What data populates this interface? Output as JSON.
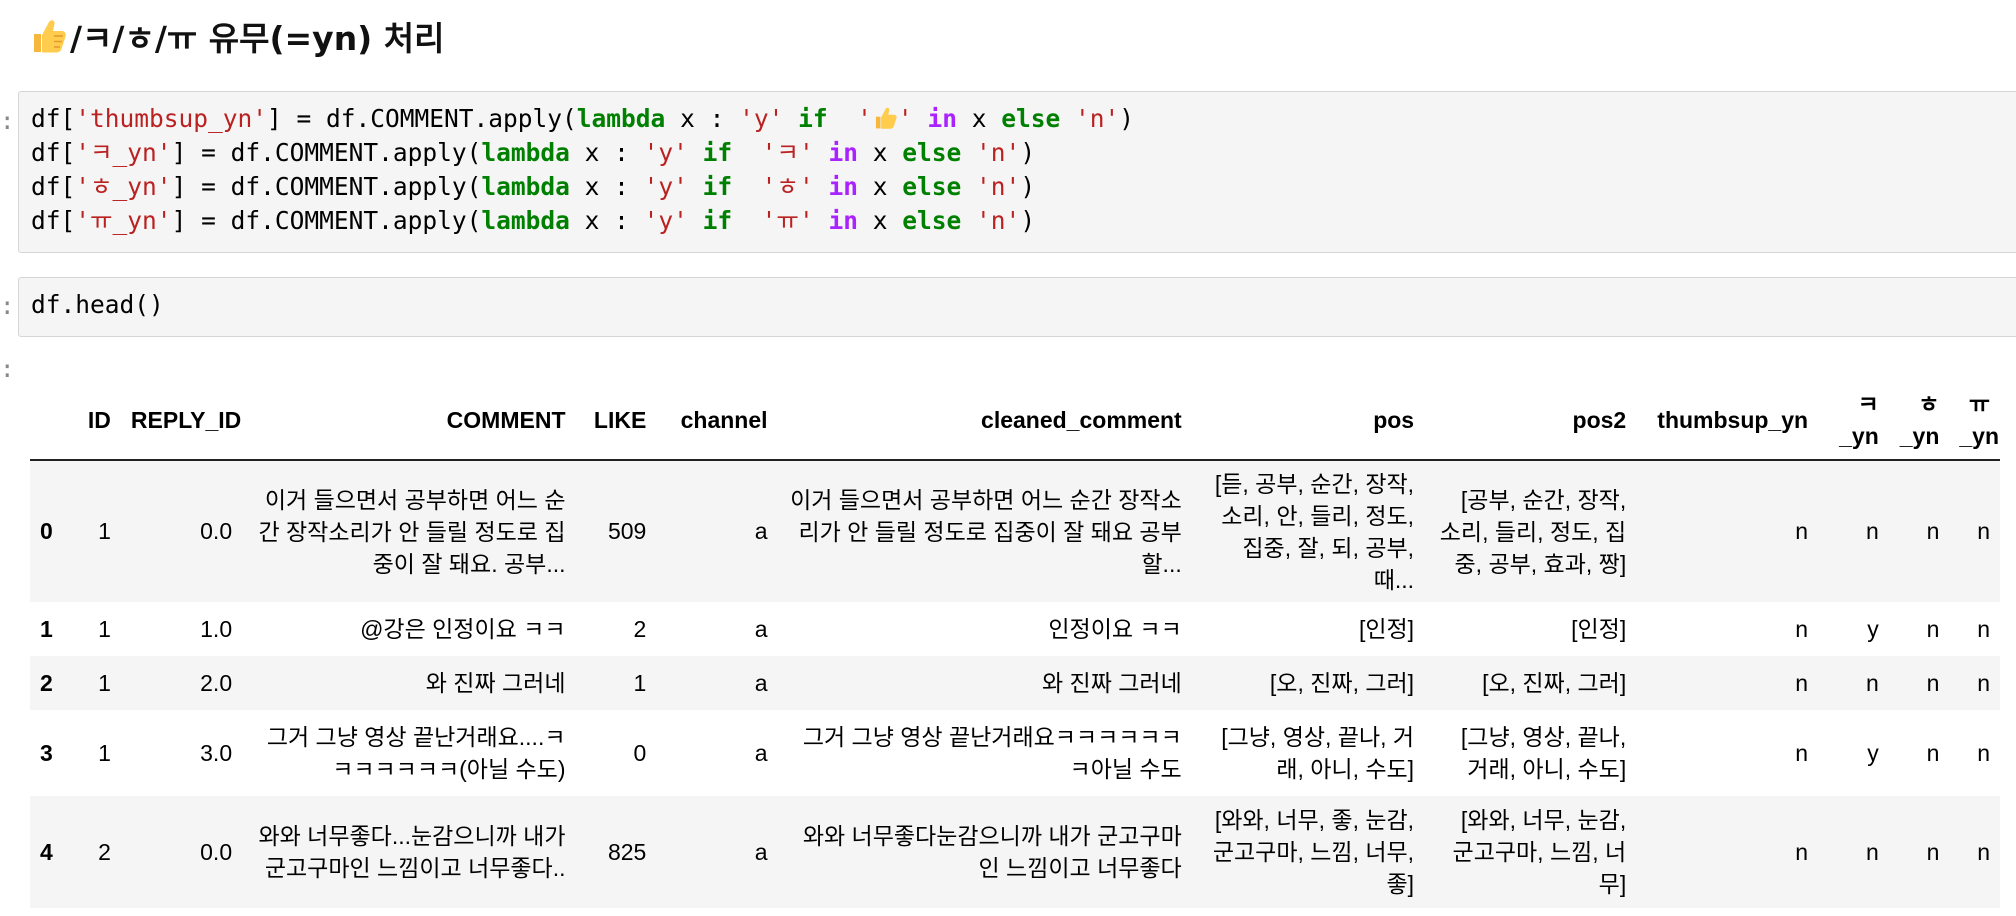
{
  "heading": {
    "text": "/ㅋ/ㅎ/ㅠ 유무(=yn) 처리",
    "icon": "thumbs-up-icon"
  },
  "cell1": {
    "lines": [
      {
        "df": "df[",
        "key": "'thumbsup_yn'",
        "mid": "] = df.COMMENT.apply(",
        "lambda": "lambda",
        "x1": " x : ",
        "y": "'y'",
        "sp": " ",
        "if": "if",
        "sp2": "  ",
        "q1": "'",
        "q2": "'",
        "in": "in",
        "x2": " x ",
        "else": "else",
        "n": "'n'",
        "close": ")"
      },
      {
        "df": "df[",
        "key": "'ㅋ_yn'",
        "mid": "] = df.COMMENT.apply(",
        "lambda": "lambda",
        "x1": " x : ",
        "y": "'y'",
        "sp": " ",
        "if": "if",
        "sp2": "  ",
        "lit": "'ㅋ'",
        "in": "in",
        "x2": " x ",
        "else": "else",
        "n": "'n'",
        "close": ")"
      },
      {
        "df": "df[",
        "key": "'ㅎ_yn'",
        "mid": "] = df.COMMENT.apply(",
        "lambda": "lambda",
        "x1": " x : ",
        "y": "'y'",
        "sp": " ",
        "if": "if",
        "sp2": "  ",
        "lit": "'ㅎ'",
        "in": "in",
        "x2": " x ",
        "else": "else",
        "n": "'n'",
        "close": ")"
      },
      {
        "df": "df[",
        "key": "'ㅠ_yn'",
        "mid": "] = df.COMMENT.apply(",
        "lambda": "lambda",
        "x1": " x : ",
        "y": "'y'",
        "sp": " ",
        "if": "if",
        "sp2": "  ",
        "lit": "'ㅠ'",
        "in": "in",
        "x2": " x ",
        "else": "else",
        "n": "'n'",
        "close": ")"
      }
    ]
  },
  "cell2": {
    "code": "df.head()"
  },
  "prompt_char": ":",
  "table": {
    "columns": [
      "",
      "ID",
      "REPLY_ID",
      "COMMENT",
      "LIKE",
      "channel",
      "cleaned_comment",
      "pos",
      "pos2",
      "thumbsup_yn",
      "ㅋ\n_yn",
      "ㅎ\n_yn",
      "ㅠ\n_yn"
    ],
    "rows": [
      [
        "0",
        "1",
        "0.0",
        "이거 들으면서 공부하면 어느 순간 장작소리가 안 들릴 정도로 집중이 잘 돼요. 공부...",
        "509",
        "a",
        "이거 들으면서 공부하면 어느 순간 장작소리가 안 들릴 정도로 집중이 잘 돼요 공부할...",
        "[듣, 공부, 순간, 장작, 소리, 안, 들리, 정도, 집중, 잘, 되, 공부, 때...",
        "[공부, 순간, 장작, 소리, 들리, 정도, 집중, 공부, 효과, 짱]",
        "n",
        "n",
        "n",
        "n"
      ],
      [
        "1",
        "1",
        "1.0",
        "@강은 인정이요 ㅋㅋ",
        "2",
        "a",
        "인정이요 ㅋㅋ",
        "[인정]",
        "[인정]",
        "n",
        "y",
        "n",
        "n"
      ],
      [
        "2",
        "1",
        "2.0",
        "와 진짜 그러네",
        "1",
        "a",
        "와 진짜 그러네",
        "[오, 진짜, 그러]",
        "[오, 진짜, 그러]",
        "n",
        "n",
        "n",
        "n"
      ],
      [
        "3",
        "1",
        "3.0",
        "그거 그냥 영상 끝난거래요....ㅋㅋㅋㅋㅋㅋㅋ(아닐 수도)",
        "0",
        "a",
        "그거 그냥 영상 끝난거래요ㅋㅋㅋㅋㅋㅋㅋ아닐 수도",
        "[그냥, 영상, 끝나, 거래, 아니, 수도]",
        "[그냥, 영상, 끝나, 거래, 아니, 수도]",
        "n",
        "y",
        "n",
        "n"
      ],
      [
        "4",
        "2",
        "0.0",
        "와와 너무좋다...눈감으니까 내가 군고구마인 느낌이고 너무좋다..",
        "825",
        "a",
        "와와 너무좋다눈감으니까 내가 군고구마인 느낌이고 너무좋다",
        "[와와, 너무, 좋, 눈감, 군고구마, 느낌, 너무, 좋]",
        "[와와, 너무, 눈감, 군고구마, 느낌, 너무]",
        "n",
        "n",
        "n",
        "n"
      ]
    ]
  }
}
